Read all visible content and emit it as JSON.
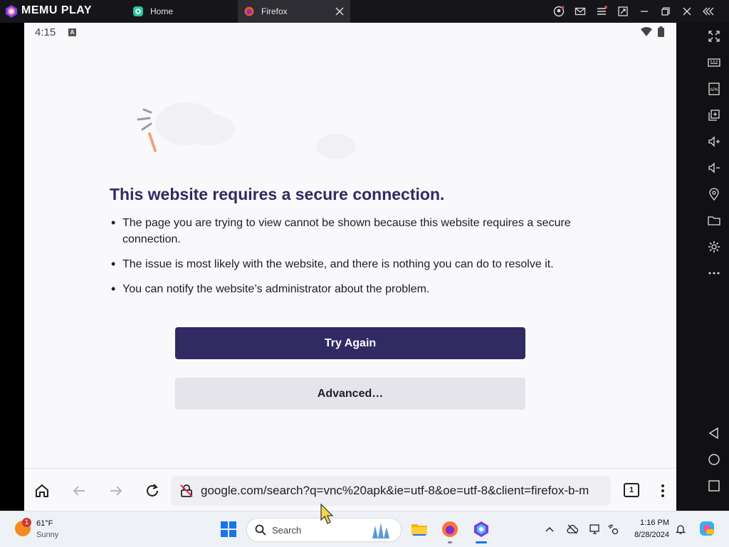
{
  "emulator": {
    "app_name": "MEMU PLAY",
    "tabs": [
      {
        "label": "Home"
      },
      {
        "label": "Firefox"
      }
    ]
  },
  "android_status": {
    "time": "4:15"
  },
  "error_page": {
    "title": "This website requires a secure connection.",
    "bullets": [
      "The page you are trying to view cannot be shown because this website requires a secure connection.",
      "The issue is most likely with the website, and there is nothing you can do to resolve it.",
      "You can notify the website’s administrator about the problem."
    ],
    "try_again_label": "Try Again",
    "advanced_label": "Advanced…"
  },
  "browser_toolbar": {
    "url": "google.com/search?q=vnc%20apk&ie=utf-8&oe=utf-8&client=firefox-b-m",
    "tab_count": "1"
  },
  "taskbar": {
    "weather_temp": "61°F",
    "weather_condition": "Sunny",
    "weather_badge": "1",
    "search_placeholder": "Search",
    "time": "1:16 PM",
    "date": "8/28/2024"
  },
  "colors": {
    "primary_button": "#312a63",
    "secondary_button": "#e4e4ea",
    "title_color": "#312a63"
  }
}
